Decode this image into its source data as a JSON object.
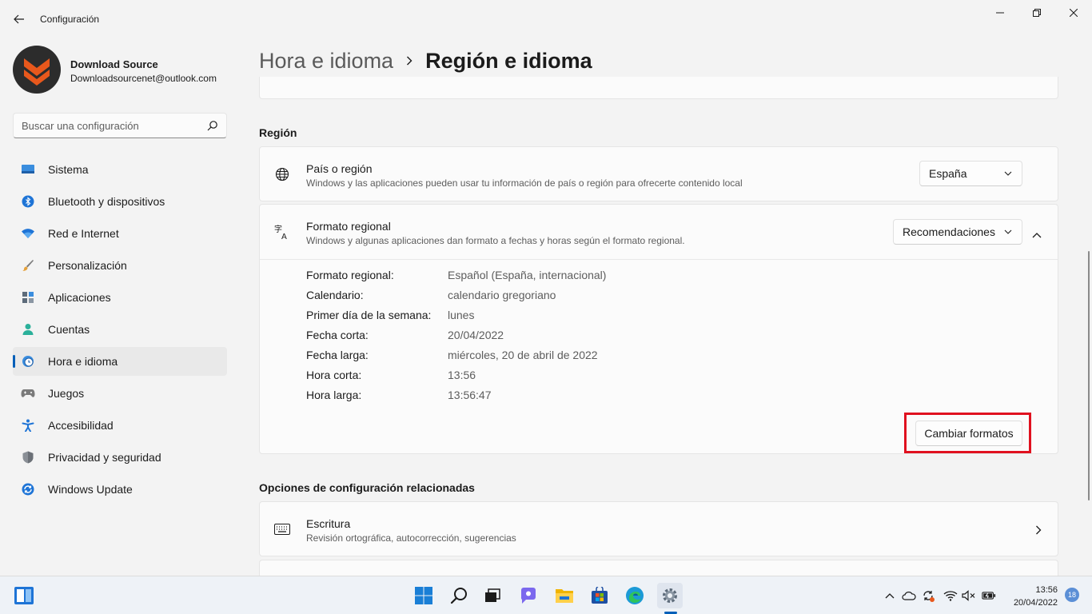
{
  "window": {
    "title": "Configuración"
  },
  "profile": {
    "name": "Download Source",
    "email": "Downloadsourcenet@outlook.com"
  },
  "search": {
    "placeholder": "Buscar una configuración"
  },
  "sidebar": {
    "items": [
      {
        "label": "Sistema",
        "icon": "system-icon"
      },
      {
        "label": "Bluetooth y dispositivos",
        "icon": "bluetooth-icon"
      },
      {
        "label": "Red e Internet",
        "icon": "wifi-icon"
      },
      {
        "label": "Personalización",
        "icon": "brush-icon"
      },
      {
        "label": "Aplicaciones",
        "icon": "apps-icon"
      },
      {
        "label": "Cuentas",
        "icon": "account-icon"
      },
      {
        "label": "Hora e idioma",
        "icon": "clock-globe-icon",
        "selected": true
      },
      {
        "label": "Juegos",
        "icon": "gamepad-icon"
      },
      {
        "label": "Accesibilidad",
        "icon": "accessibility-icon"
      },
      {
        "label": "Privacidad y seguridad",
        "icon": "shield-icon"
      },
      {
        "label": "Windows Update",
        "icon": "update-icon"
      }
    ]
  },
  "breadcrumb": {
    "parent": "Hora e idioma",
    "current": "Región e idioma"
  },
  "region": {
    "section_title": "Región",
    "country": {
      "title": "País o región",
      "description": "Windows y las aplicaciones pueden usar tu información de país o región para ofrecerte contenido local",
      "value": "España"
    },
    "format": {
      "title": "Formato regional",
      "description": "Windows y algunas aplicaciones dan formato a fechas y horas según el formato regional.",
      "value": "Recomendaciones",
      "details": [
        {
          "label": "Formato regional:",
          "value": "Español (España, internacional)"
        },
        {
          "label": "Calendario:",
          "value": "calendario gregoriano"
        },
        {
          "label": "Primer día de la semana:",
          "value": "lunes"
        },
        {
          "label": "Fecha corta:",
          "value": "20/04/2022"
        },
        {
          "label": "Fecha larga:",
          "value": "miércoles, 20 de abril de 2022"
        },
        {
          "label": "Hora corta:",
          "value": "13:56"
        },
        {
          "label": "Hora larga:",
          "value": "13:56:47"
        }
      ],
      "change_button": "Cambiar formatos"
    }
  },
  "related": {
    "section_title": "Opciones de configuración relacionadas",
    "items": [
      {
        "title": "Escritura",
        "description": "Revisión ortográfica, autocorrección, sugerencias"
      }
    ]
  },
  "taskbar": {
    "time": "13:56",
    "date": "20/04/2022",
    "notifications": "18"
  },
  "colors": {
    "accent": "#005fb8",
    "highlight": "#e0111f",
    "logo_orange": "#e8581c"
  }
}
